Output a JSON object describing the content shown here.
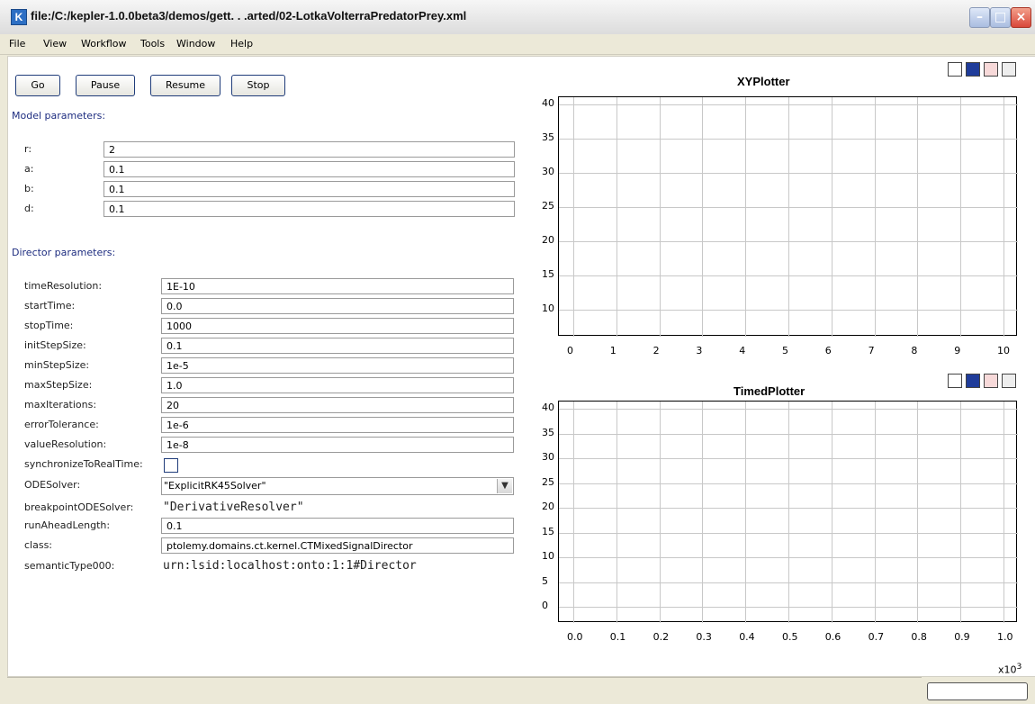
{
  "window": {
    "title": "file:/C:/kepler-1.0.0beta3/demos/gett. . .arted/02-LotkaVolterraPredatorPrey.xml",
    "app_icon": "K"
  },
  "menu": [
    "File",
    "View",
    "Workflow",
    "Tools",
    "Window",
    "Help"
  ],
  "controls": {
    "go": "Go",
    "pause": "Pause",
    "resume": "Resume",
    "stop": "Stop"
  },
  "model": {
    "label": "Model parameters:",
    "params": [
      {
        "label": "r:",
        "value": "2"
      },
      {
        "label": "a:",
        "value": "0.1"
      },
      {
        "label": "b:",
        "value": "0.1"
      },
      {
        "label": "d:",
        "value": "0.1"
      }
    ]
  },
  "director": {
    "label": "Director parameters:",
    "params": [
      {
        "label": "timeResolution:",
        "value": "1E-10"
      },
      {
        "label": "startTime:",
        "value": "0.0"
      },
      {
        "label": "stopTime:",
        "value": "1000"
      },
      {
        "label": "initStepSize:",
        "value": "0.1"
      },
      {
        "label": "minStepSize:",
        "value": "1e-5"
      },
      {
        "label": "maxStepSize:",
        "value": "1.0"
      },
      {
        "label": "maxIterations:",
        "value": "20"
      },
      {
        "label": "errorTolerance:",
        "value": "1e-6"
      },
      {
        "label": "valueResolution:",
        "value": "1e-8"
      }
    ],
    "sync_label": "synchronizeToRealTime:",
    "ode_label": "ODESolver:",
    "ode_value": "\"ExplicitRK45Solver\"",
    "breakpoint_label": "breakpointODESolver:",
    "breakpoint_value": "\"DerivativeResolver\"",
    "runahead_label": "runAheadLength:",
    "runahead_value": "0.1",
    "class_label": "class:",
    "class_value": "ptolemy.domains.ct.kernel.CTMixedSignalDirector",
    "semantic_label": "semanticType000:",
    "semantic_value": "urn:lsid:localhost:onto:1:1#Director"
  },
  "plots": {
    "xy_title": "XYPlotter",
    "timed_title": "TimedPlotter",
    "xy_yticks": [
      "40",
      "35",
      "30",
      "25",
      "20",
      "15",
      "10"
    ],
    "xy_xticks": [
      "0",
      "1",
      "2",
      "3",
      "4",
      "5",
      "6",
      "7",
      "8",
      "9",
      "10"
    ],
    "timed_yticks": [
      "40",
      "35",
      "30",
      "25",
      "20",
      "15",
      "10",
      "5",
      "0"
    ],
    "timed_xticks": [
      "0.0",
      "0.1",
      "0.2",
      "0.3",
      "0.4",
      "0.5",
      "0.6",
      "0.7",
      "0.8",
      "0.9",
      "1.0"
    ],
    "timed_xexp_base": "x10",
    "timed_xexp_pow": "3"
  },
  "colors": {
    "section_label": "#1e2d80",
    "accent_blue": "#1f3c7a"
  }
}
